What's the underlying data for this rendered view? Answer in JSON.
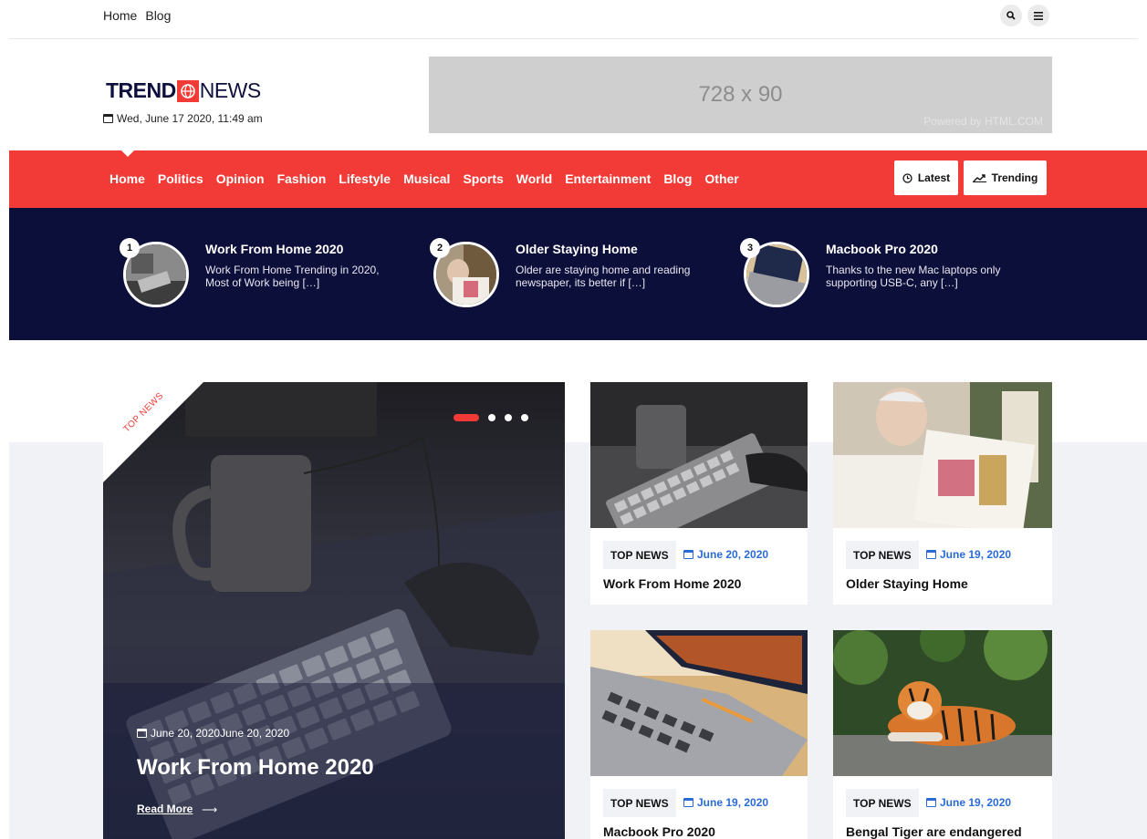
{
  "topbar": {
    "links": [
      "Home",
      "Blog"
    ]
  },
  "brand": {
    "trend": "TREND",
    "news": "NEWS",
    "date": "Wed, June 17 2020, 11:49 am"
  },
  "ad": {
    "size": "728 x 90",
    "powered": "Powered by HTML.COM"
  },
  "nav": {
    "items": [
      "Home",
      "Politics",
      "Opinion",
      "Fashion",
      "Lifestyle",
      "Musical",
      "Sports",
      "World",
      "Entertainment",
      "Blog",
      "Other"
    ],
    "latest": "Latest",
    "trending": "Trending"
  },
  "ticker": [
    {
      "num": "1",
      "title": "Work From Home 2020",
      "desc": "Work From Home Trending in 2020, Most of Work being […]"
    },
    {
      "num": "2",
      "title": "Older Staying Home",
      "desc": "Older are staying home and reading newspaper, its better if […]"
    },
    {
      "num": "3",
      "title": "Macbook Pro 2020",
      "desc": "Thanks to the new Mac laptops only supporting USB-C, any […]"
    }
  ],
  "hero": {
    "ribbon": "TOP NEWS",
    "date": "June 20, 2020June 20, 2020",
    "title": "Work From Home 2020",
    "read_more": "Read More"
  },
  "cards": [
    {
      "tag": "TOP NEWS",
      "date": "June 20, 2020",
      "title": "Work From Home 2020"
    },
    {
      "tag": "TOP NEWS",
      "date": "June 19, 2020",
      "title": "Older Staying Home"
    },
    {
      "tag": "TOP NEWS",
      "date": "June 19, 2020",
      "title": "Macbook Pro 2020"
    },
    {
      "tag": "TOP NEWS",
      "date": "June 19, 2020",
      "title": "Bengal Tiger are endangered"
    }
  ],
  "colors": {
    "accent": "#f23b36",
    "navy": "#0c0f3a",
    "link": "#2a6bd6"
  }
}
